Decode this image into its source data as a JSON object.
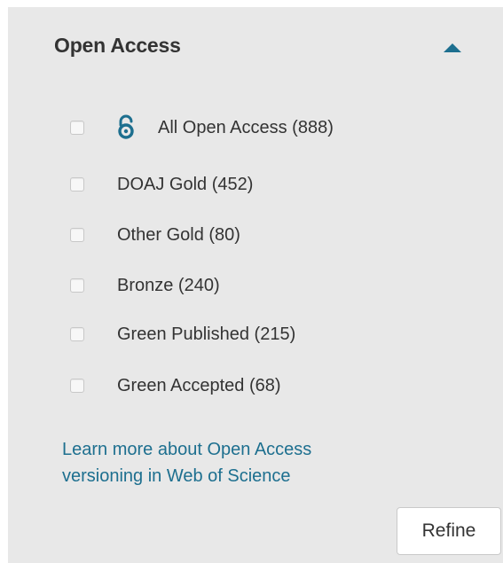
{
  "section": {
    "title": "Open Access",
    "toggle_icon": "caret-up-icon",
    "accent_color": "#1d6f8f"
  },
  "options": [
    {
      "label": "All Open Access (888)",
      "checked": false,
      "icon": "open-access-icon"
    },
    {
      "label": "DOAJ Gold (452)",
      "checked": false
    },
    {
      "label": "Other Gold (80)",
      "checked": false
    },
    {
      "label": "Bronze (240)",
      "checked": false
    },
    {
      "label": "Green Published (215)",
      "checked": false
    },
    {
      "label": "Green Accepted (68)",
      "checked": false
    }
  ],
  "learn_more": {
    "line1": "Learn more about Open Access",
    "line2": "versioning in Web of Science"
  },
  "refine_button": {
    "label": "Refine"
  }
}
